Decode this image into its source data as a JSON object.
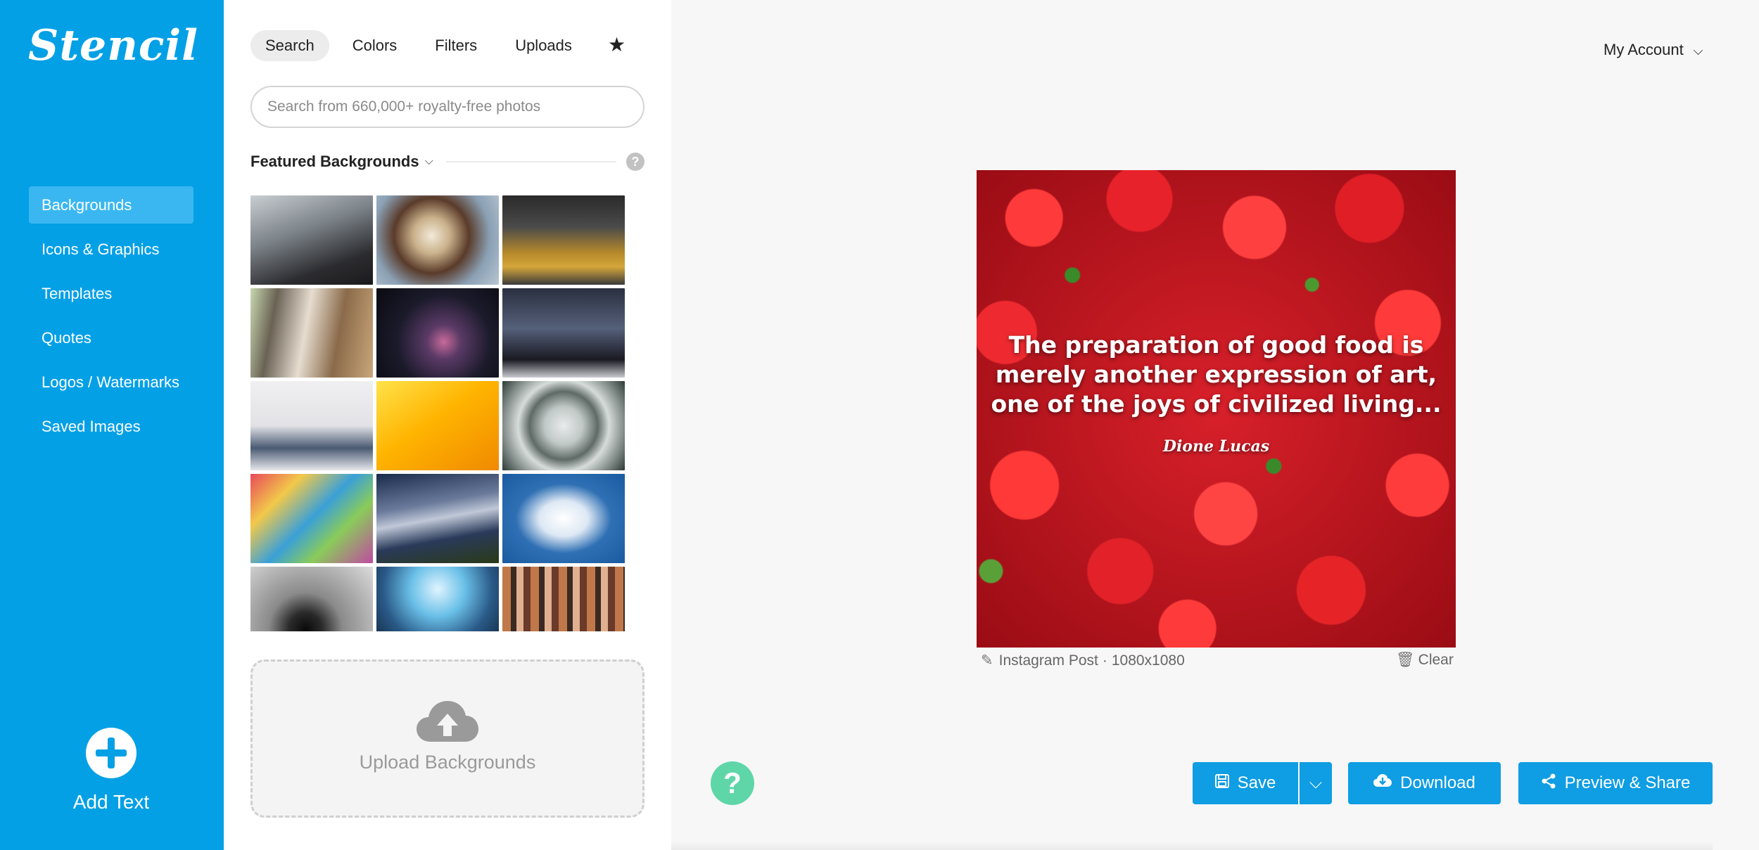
{
  "app": {
    "logo": "Stencil"
  },
  "sidebar": {
    "items": [
      {
        "label": "Backgrounds",
        "active": true
      },
      {
        "label": "Icons & Graphics"
      },
      {
        "label": "Templates"
      },
      {
        "label": "Quotes"
      },
      {
        "label": "Logos / Watermarks"
      },
      {
        "label": "Saved Images"
      }
    ],
    "add_text_label": "Add Text",
    "color": "#03a0e6"
  },
  "panel": {
    "tabs": [
      {
        "label": "Search",
        "active": true
      },
      {
        "label": "Colors"
      },
      {
        "label": "Filters"
      },
      {
        "label": "Uploads"
      }
    ],
    "favorites_icon": "star-icon",
    "search": {
      "placeholder": "Search from 660,000+ royalty-free photos",
      "value": ""
    },
    "section_title": "Featured Backgrounds",
    "help_glyph": "?",
    "thumbnails": [
      "people with umbrella in snow",
      "coffee cup and cookies",
      "man on yellow sofa",
      "man at table",
      "starry night arch",
      "row of legs and shoes",
      "person in white snow",
      "yellow gradient",
      "glass dome ceiling",
      "colorful abstract",
      "night sky streaks",
      "heart-shaped cloud",
      "coffee cup and glasses",
      "concert crowd",
      "crowd of people"
    ],
    "upload_label": "Upload Backgrounds"
  },
  "header": {
    "account_label": "My Account"
  },
  "canvas": {
    "quote_lines": [
      "The preparation of good food is",
      "merely another expression of art,",
      "one of the joys of civilized living..."
    ],
    "author": "Dione Lucas",
    "format": "Instagram Post",
    "size": "1080x1080",
    "separator": "·",
    "clear_label": "Clear"
  },
  "help_glyph": "?",
  "actions": {
    "save_label": "Save",
    "download_label": "Download",
    "share_label": "Preview & Share",
    "accent": "#0f9de3",
    "help_color": "#5fd6a8"
  }
}
